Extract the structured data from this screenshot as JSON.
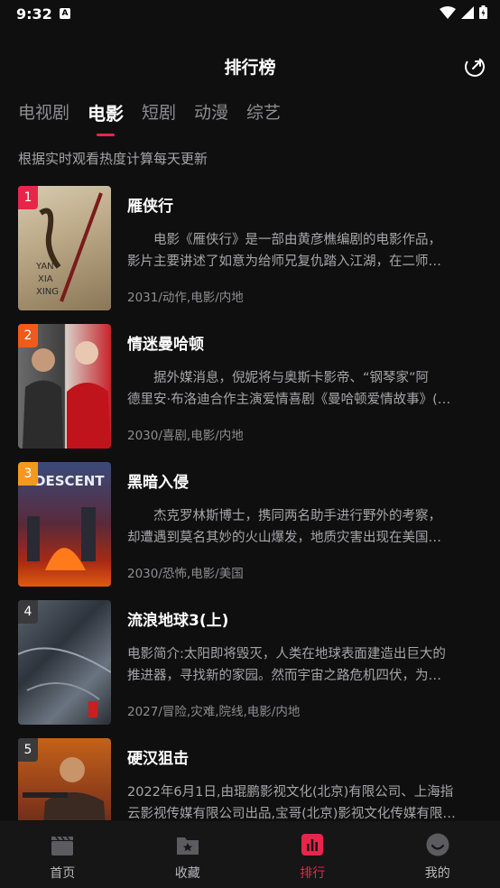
{
  "status": {
    "time": "9:32"
  },
  "header": {
    "title": "排行榜"
  },
  "tabs": [
    {
      "label": "电视剧",
      "active": false
    },
    {
      "label": "电影",
      "active": true
    },
    {
      "label": "短剧",
      "active": false
    },
    {
      "label": "动漫",
      "active": false
    },
    {
      "label": "综艺",
      "active": false
    }
  ],
  "subtitle": "根据实时观看热度计算每天更新",
  "items": [
    {
      "rank": "1",
      "rank_color": "#e8264a",
      "name": "雁侠行",
      "desc1": "　　电影《雁侠行》是一部由黄彦樵编剧的电影作品，",
      "desc2": "影片主要讲述了如意为给师兄复仇踏入江湖，在二师…",
      "meta": "2031/动作,电影/内地",
      "poster_text": "YAN\nXIA\nXING"
    },
    {
      "rank": "2",
      "rank_color": "#f05a1a",
      "name": "情迷曼哈顿",
      "desc1": "　　据外媒消息，倪妮将与奥斯卡影帝、“钢琴家”阿",
      "desc2": "德里安·布洛迪合作主演爱情喜剧《曼哈顿爱情故事》(…",
      "meta": "2030/喜剧,电影/内地"
    },
    {
      "rank": "3",
      "rank_color": "#f39a1e",
      "name": "黑暗入侵",
      "desc1": "　　杰克罗林斯博士，携同两名助手进行野外的考察，",
      "desc2": "却遭遇到莫名其妙的火山爆发，地质灾害出现在美国…",
      "meta": "2030/恐怖,电影/美国",
      "poster_text": "DESCENT"
    },
    {
      "rank": "4",
      "rank_color": "#3a3a3c",
      "name": "流浪地球3(上)",
      "desc1": "电影简介:太阳即将毁灭，人类在地球表面建造出巨大的",
      "desc2": "推进器，寻找新的家园。然而宇宙之路危机四伏，为…",
      "meta": "2027/冒险,灾难,院线,电影/内地"
    },
    {
      "rank": "5",
      "rank_color": "#3a3a3c",
      "name": "硬汉狙击",
      "desc1": "2022年6月1日,由琨鹏影视文化(北京)有限公司、上海指",
      "desc2": "云影视传媒有限公司出品,宝哥(北京)影视文化传媒有限…",
      "meta": ""
    }
  ],
  "bottom_nav": [
    {
      "label": "首页",
      "icon": "clapperboard-icon",
      "active": false
    },
    {
      "label": "收藏",
      "icon": "folder-star-icon",
      "active": false
    },
    {
      "label": "排行",
      "icon": "chart-icon",
      "active": true
    },
    {
      "label": "我的",
      "icon": "smile-icon",
      "active": false
    }
  ],
  "colors": {
    "accent": "#e8264a",
    "background": "#0f0f10"
  }
}
